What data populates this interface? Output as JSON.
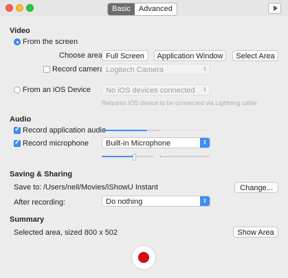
{
  "tabs": {
    "basic": "Basic",
    "advanced": "Advanced"
  },
  "video": {
    "title": "Video",
    "from_screen": "From the screen",
    "choose_area": "Choose area",
    "full_screen": "Full Screen",
    "application_window": "Application Window",
    "select_area": "Select Area",
    "record_camera": "Record camera",
    "camera_value": "Logitech Camera",
    "from_ios": "From an iOS Device",
    "ios_value": "No iOS devices connected",
    "ios_hint": "Requires iOS device to be connected via Lightning cable"
  },
  "audio": {
    "title": "Audio",
    "record_app_audio": "Record application audio",
    "app_audio_level": 0.69,
    "record_mic": "Record microphone",
    "mic_value": "Built-in Microphone",
    "mic_level": 0.62,
    "mic_meter_level": 0.02
  },
  "saving": {
    "title": "Saving & Sharing",
    "save_to_label": "Save to:",
    "save_path": "/Users/neil/Movies/iShowU Instant",
    "change_button": "Change...",
    "after_label": "After recording:",
    "after_value": "Do nothing"
  },
  "summary": {
    "title": "Summary",
    "text": "Selected area, sized 800 x 502",
    "show_area_button": "Show Area"
  },
  "colors": {
    "accent": "#3e8ef7",
    "record": "#d10f14"
  },
  "icons": {
    "play": "play-icon",
    "record": "record-icon",
    "arrow": "up-down-arrows-icon"
  }
}
